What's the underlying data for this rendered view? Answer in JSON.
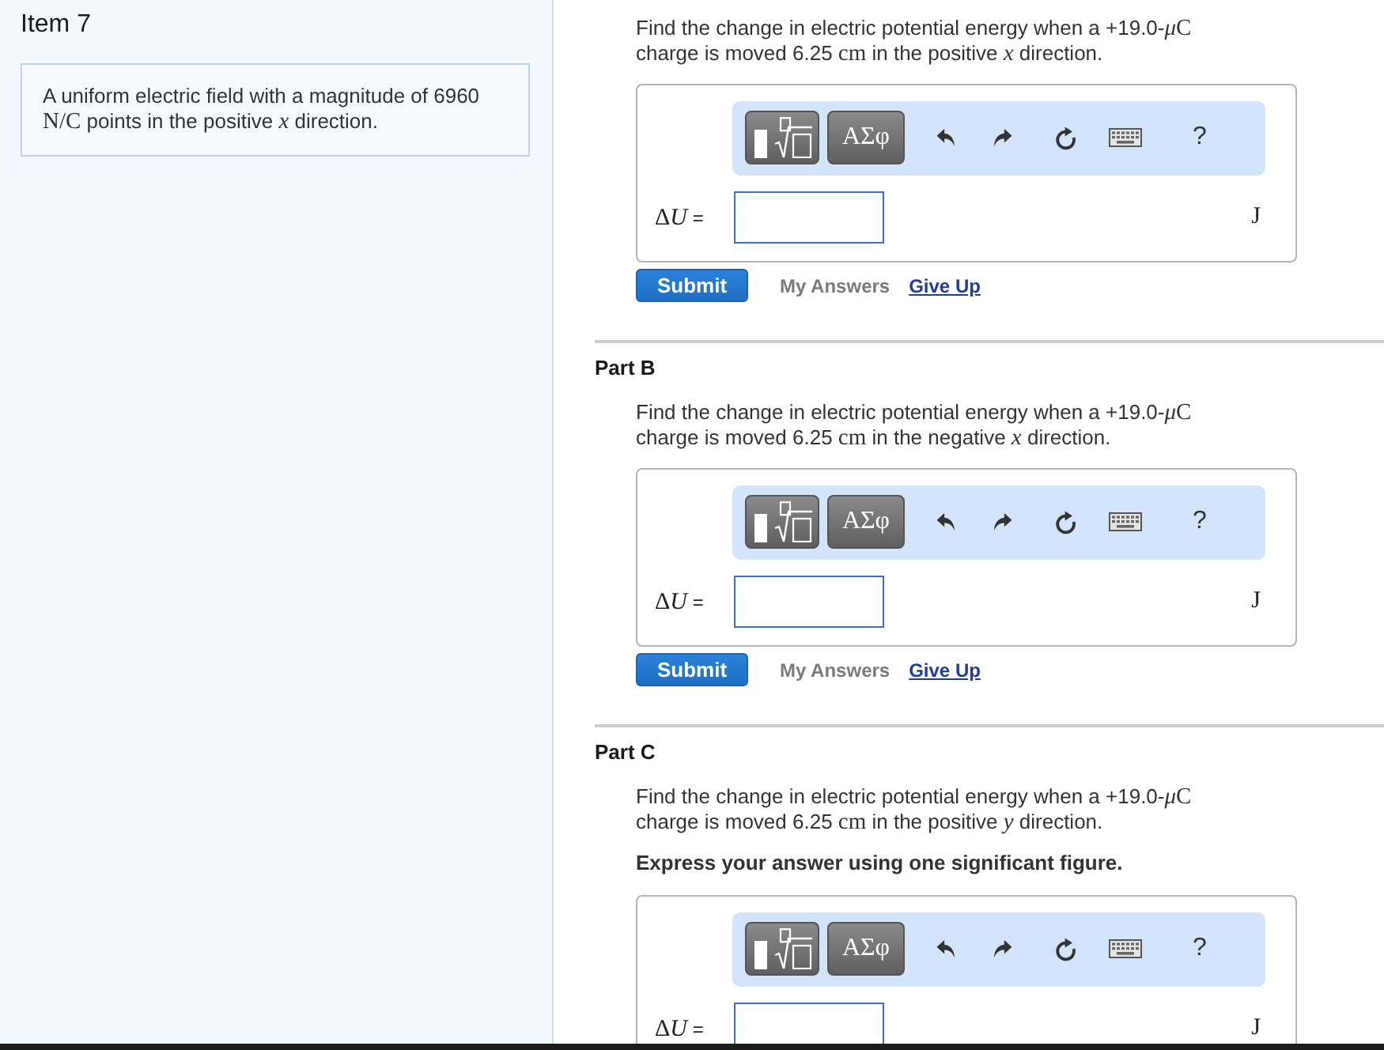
{
  "item": {
    "title": "Item 7",
    "intro": [
      {
        "kind": "text",
        "text": "A uniform electric field with a magnitude of 6960 "
      },
      {
        "kind": "math",
        "text": "N/C"
      },
      {
        "kind": "text",
        "text": " points in the positive "
      },
      {
        "kind": "math",
        "text": "*x*"
      },
      {
        "kind": "text",
        "text": " direction."
      }
    ]
  },
  "parts": [
    {
      "question": [
        {
          "kind": "text",
          "text": "Find the change in electric potential energy when a +19.0-"
        },
        {
          "kind": "math",
          "text": "*μ*"
        },
        {
          "kind": "math",
          "text": "C"
        },
        {
          "kind": "text",
          "text": " charge is moved 6.25 "
        },
        {
          "kind": "math",
          "text": "cm"
        },
        {
          "kind": "text",
          "text": " in the positive "
        },
        {
          "kind": "math",
          "text": "*x*"
        },
        {
          "kind": "text",
          "text": " direction."
        }
      ],
      "answer": {
        "symbols_label": "ΑΣφ",
        "help_label": "?",
        "label": [
          {
            "kind": "math",
            "text": "Δ"
          },
          {
            "kind": "math",
            "text": "*U*"
          },
          {
            "kind": "text",
            "text": " ="
          }
        ],
        "unit": "J"
      },
      "actions": {
        "submit": "Submit",
        "my_answers": {
          "label": "My Answers",
          "disabled": true
        },
        "give_up": "Give Up"
      }
    },
    {
      "heading": "Part B",
      "question": [
        {
          "kind": "text",
          "text": "Find the change in electric potential energy when a +19.0-"
        },
        {
          "kind": "math",
          "text": "*μ*"
        },
        {
          "kind": "math",
          "text": "C"
        },
        {
          "kind": "text",
          "text": " charge is moved 6.25 "
        },
        {
          "kind": "math",
          "text": "cm"
        },
        {
          "kind": "text",
          "text": " in the negative "
        },
        {
          "kind": "math",
          "text": "*x*"
        },
        {
          "kind": "text",
          "text": " direction."
        }
      ],
      "answer": {
        "symbols_label": "ΑΣφ",
        "help_label": "?",
        "label": [
          {
            "kind": "math",
            "text": "Δ"
          },
          {
            "kind": "math",
            "text": "*U*"
          },
          {
            "kind": "text",
            "text": " ="
          }
        ],
        "unit": "J"
      },
      "actions": {
        "submit": "Submit",
        "my_answers": {
          "label": "My Answers",
          "disabled": true
        },
        "give_up": "Give Up"
      }
    },
    {
      "heading": "Part C",
      "question": [
        {
          "kind": "text",
          "text": "Find the change in electric potential energy when a +19.0-"
        },
        {
          "kind": "math",
          "text": "*μ*"
        },
        {
          "kind": "math",
          "text": "C"
        },
        {
          "kind": "text",
          "text": " charge is moved 6.25 "
        },
        {
          "kind": "math",
          "text": "cm"
        },
        {
          "kind": "text",
          "text": " in the positive "
        },
        {
          "kind": "math",
          "text": "*y*"
        },
        {
          "kind": "text",
          "text": " direction."
        }
      ],
      "instruction": "Express your answer using one significant figure.",
      "answer": {
        "symbols_label": "ΑΣφ",
        "help_label": "?",
        "label": [
          {
            "kind": "math",
            "text": "Δ"
          },
          {
            "kind": "math",
            "text": "*U*"
          },
          {
            "kind": "text",
            "text": " ="
          }
        ],
        "unit": "J"
      }
    }
  ]
}
